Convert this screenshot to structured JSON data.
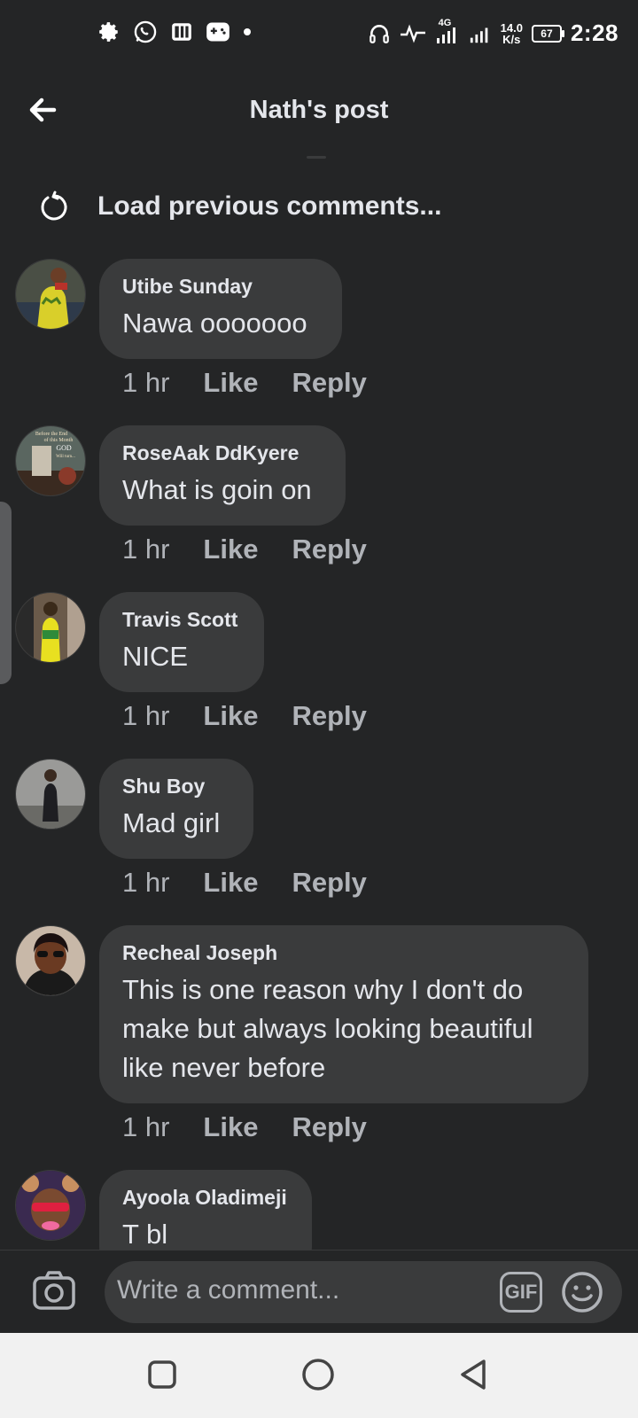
{
  "status_bar": {
    "time": "2:28",
    "network_type": "4G",
    "speed_value": "14.0",
    "speed_unit": "K/s",
    "battery": "67",
    "icons_left": [
      "gear-icon",
      "whatsapp-icon",
      "news-icon",
      "game-icon",
      "dot-icon"
    ],
    "icons_right": [
      "headphones-icon",
      "activity-icon",
      "signal-icon",
      "signal-icon",
      "battery-icon"
    ]
  },
  "header": {
    "title": "Nath's post",
    "back_icon": "arrow-left-icon"
  },
  "load_previous": {
    "label": "Load previous comments...",
    "icon": "refresh-icon"
  },
  "comments": [
    {
      "name": "Utibe Sunday",
      "text": "Nawa ooooooo",
      "time": "1 hr",
      "like": "Like",
      "reply": "Reply"
    },
    {
      "name": "RoseAak DdKyere",
      "text": "What is goin on",
      "time": "1 hr",
      "like": "Like",
      "reply": "Reply",
      "avatar_text": [
        "Before the End",
        "of this Month",
        "GOD",
        "Will turn..."
      ]
    },
    {
      "name": "Travis Scott",
      "text": "NICE",
      "time": "1 hr",
      "like": "Like",
      "reply": "Reply"
    },
    {
      "name": "Shu Boy",
      "text": "Mad girl",
      "time": "1 hr",
      "like": "Like",
      "reply": "Reply"
    },
    {
      "name": "Recheal Joseph",
      "text": "This is one reason why I don't do make but always looking beautiful like never before",
      "time": "1 hr",
      "like": "Like",
      "reply": "Reply"
    },
    {
      "name": "Ayoola Oladimeji",
      "text": "T   bl",
      "time": "",
      "like": "",
      "reply": ""
    }
  ],
  "composer": {
    "placeholder": "Write a comment...",
    "gif_label": "GIF",
    "camera_icon": "camera-icon",
    "emoji_icon": "smile-icon"
  },
  "nav_bar": {
    "icons": [
      "recents-square-icon",
      "home-circle-icon",
      "back-triangle-icon"
    ]
  },
  "colors": {
    "background": "#242526",
    "bubble": "#3a3b3c",
    "primary_text": "#e4e6eb",
    "secondary_text": "#b0b3b8",
    "nav_bg": "#f1f1f1"
  }
}
